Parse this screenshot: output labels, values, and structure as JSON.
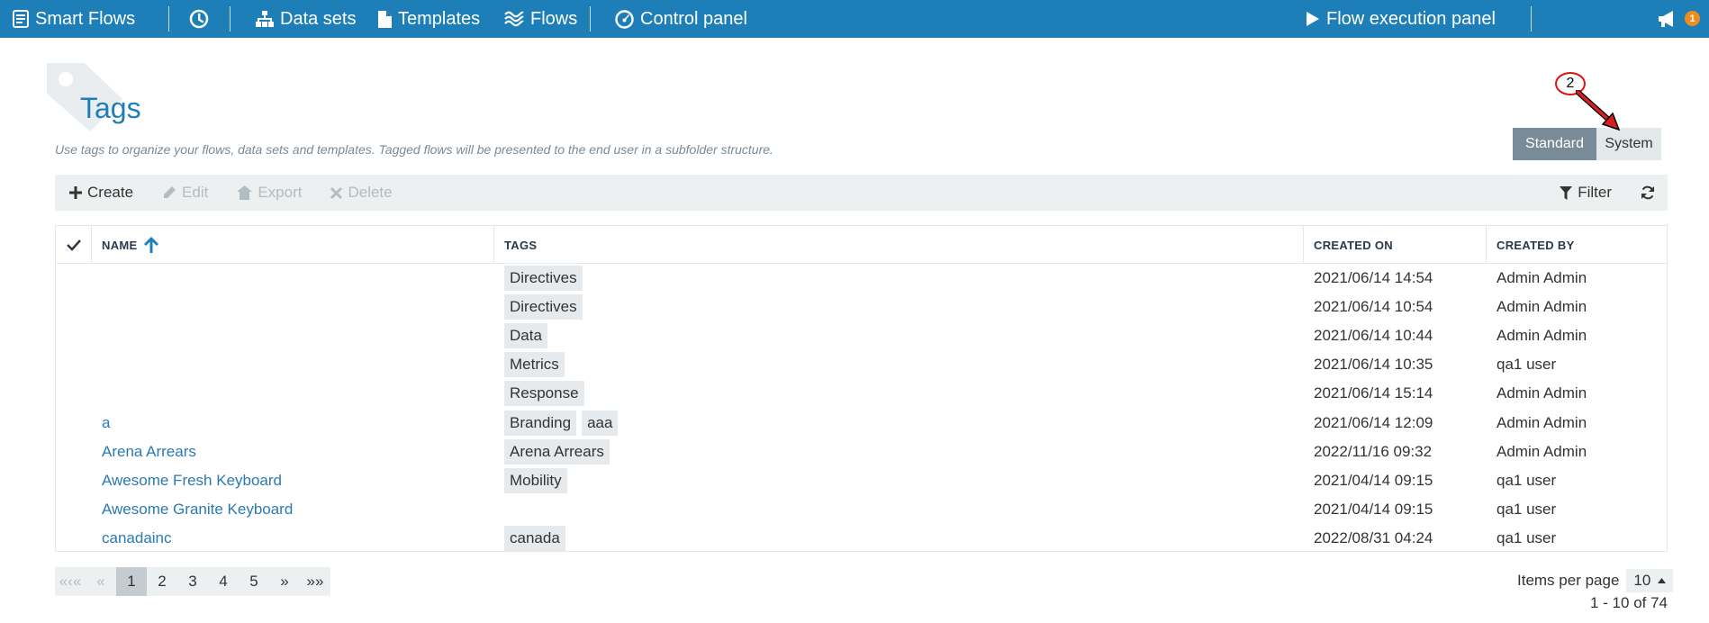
{
  "nav": {
    "brand": "Smart Flows",
    "datasets": "Data sets",
    "templates": "Templates",
    "flows": "Flows",
    "control_panel": "Control panel",
    "execution_panel": "Flow execution panel",
    "notification_count": "1"
  },
  "page": {
    "title": "Tags",
    "subtitle": "Use tags to organize your flows, data sets and templates. Tagged flows will be presented to the end user in a subfolder structure."
  },
  "toggle": {
    "standard": "Standard",
    "system": "System"
  },
  "annotation": {
    "label": "2"
  },
  "toolbar": {
    "create": "Create",
    "edit": "Edit",
    "export": "Export",
    "delete": "Delete",
    "filter": "Filter"
  },
  "grid": {
    "columns": {
      "name": "NAME",
      "tags": "TAGS",
      "created_on": "CREATED ON",
      "created_by": "CREATED BY"
    },
    "rows": [
      {
        "name": "",
        "tags": [
          "Directives"
        ],
        "created_on": "2021/06/14 14:54",
        "created_by": "Admin Admin"
      },
      {
        "name": "",
        "tags": [
          "Directives"
        ],
        "created_on": "2021/06/14 10:54",
        "created_by": "Admin Admin"
      },
      {
        "name": "",
        "tags": [
          "Data"
        ],
        "created_on": "2021/06/14 10:44",
        "created_by": "Admin Admin"
      },
      {
        "name": "",
        "tags": [
          "Metrics"
        ],
        "created_on": "2021/06/14 10:35",
        "created_by": "qa1 user"
      },
      {
        "name": "",
        "tags": [
          "Response"
        ],
        "created_on": "2021/06/14 15:14",
        "created_by": "Admin Admin"
      },
      {
        "name": "a",
        "tags": [
          "Branding",
          "aaa"
        ],
        "created_on": "2021/06/14 12:09",
        "created_by": "Admin Admin"
      },
      {
        "name": "Arena Arrears",
        "tags": [
          "Arena Arrears"
        ],
        "created_on": "2022/11/16 09:32",
        "created_by": "Admin Admin"
      },
      {
        "name": "Awesome Fresh Keyboard",
        "tags": [
          "Mobility"
        ],
        "created_on": "2021/04/14 09:15",
        "created_by": "qa1 user"
      },
      {
        "name": "Awesome Granite Keyboard",
        "tags": [],
        "created_on": "2021/04/14 09:15",
        "created_by": "qa1 user"
      },
      {
        "name": "canadainc",
        "tags": [
          "canada"
        ],
        "created_on": "2022/08/31 04:24",
        "created_by": "qa1 user"
      }
    ]
  },
  "pager": {
    "first": "«‹«",
    "prev": "«",
    "pages": [
      "1",
      "2",
      "3",
      "4",
      "5"
    ],
    "next": "»",
    "last": "»»",
    "items_per_page_label": "Items per page",
    "items_per_page": "10",
    "range": "1 - 10 of 74"
  }
}
